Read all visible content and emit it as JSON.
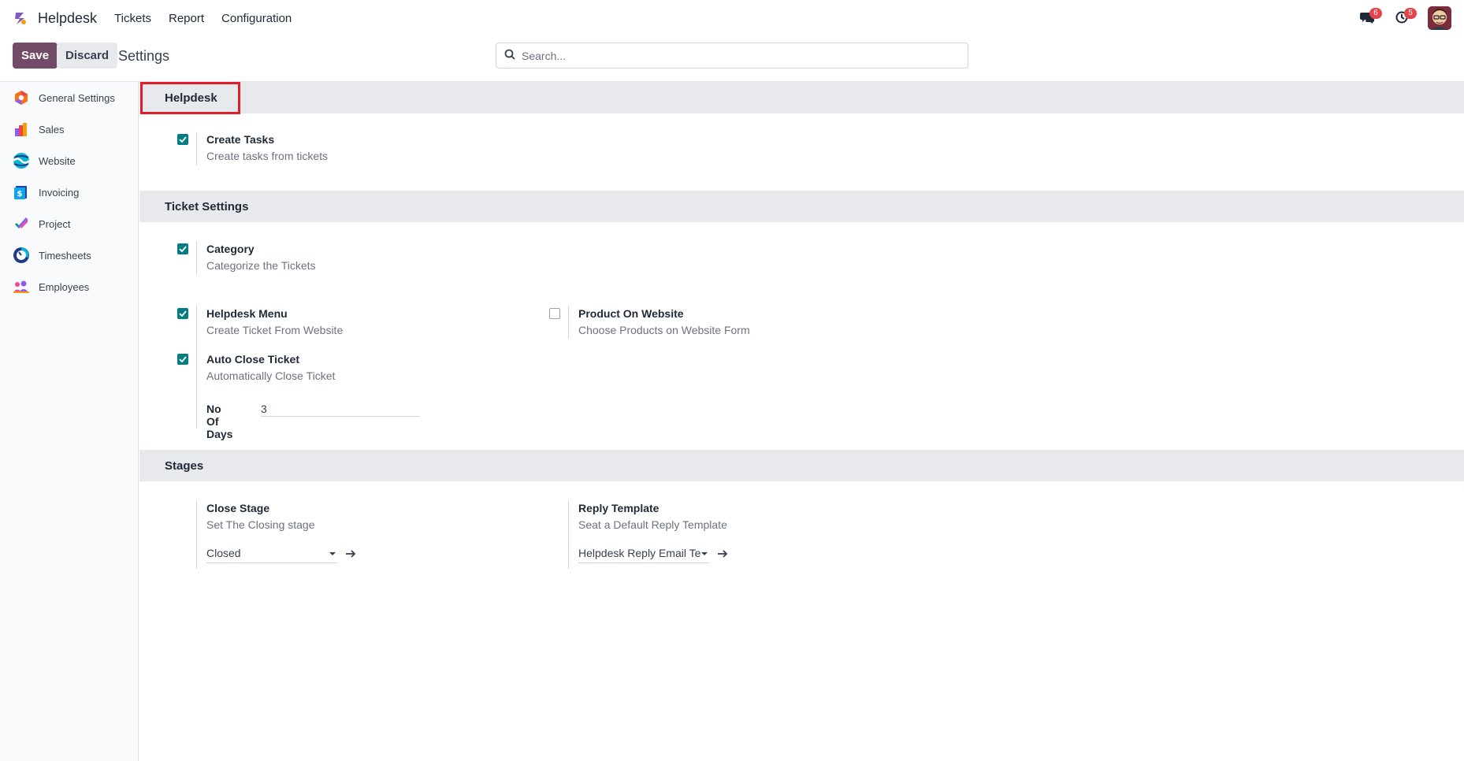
{
  "navbar": {
    "brand": "Helpdesk",
    "menu": [
      "Tickets",
      "Report",
      "Configuration"
    ],
    "messages_count": "6",
    "activities_count": "5"
  },
  "control_panel": {
    "save_label": "Save",
    "discard_label": "Discard",
    "title": "Settings",
    "search_placeholder": "Search..."
  },
  "sidebar": {
    "items": [
      {
        "label": "General Settings",
        "icon": "general-settings-icon"
      },
      {
        "label": "Sales",
        "icon": "sales-icon"
      },
      {
        "label": "Website",
        "icon": "website-icon"
      },
      {
        "label": "Invoicing",
        "icon": "invoicing-icon"
      },
      {
        "label": "Project",
        "icon": "project-icon"
      },
      {
        "label": "Timesheets",
        "icon": "timesheets-icon"
      },
      {
        "label": "Employees",
        "icon": "employees-icon"
      }
    ]
  },
  "sections": {
    "helpdesk": {
      "title": "Helpdesk",
      "create_tasks": {
        "title": "Create Tasks",
        "desc": "Create tasks from tickets",
        "checked": true
      }
    },
    "ticket_settings": {
      "title": "Ticket Settings",
      "category": {
        "title": "Category",
        "desc": "Categorize the Tickets",
        "checked": true
      },
      "helpdesk_menu": {
        "title": "Helpdesk Menu",
        "desc": "Create Ticket From Website",
        "checked": true
      },
      "product_on_website": {
        "title": "Product On Website",
        "desc": "Choose Products on Website Form",
        "checked": false
      },
      "auto_close": {
        "title": "Auto Close Ticket",
        "desc": "Automatically Close Ticket",
        "checked": true,
        "days_label": "No Of Days",
        "days_value": "3"
      }
    },
    "stages": {
      "title": "Stages",
      "close_stage": {
        "title": "Close Stage",
        "desc": "Set The Closing stage",
        "value": "Closed"
      },
      "reply_template": {
        "title": "Reply Template",
        "desc": "Seat a Default Reply Template",
        "value": "Helpdesk Reply Email Template"
      }
    }
  },
  "colors": {
    "primary": "#714b67",
    "check_on": "#017e84",
    "section_bg": "#e7e9ed",
    "highlight": "#e11d28"
  }
}
